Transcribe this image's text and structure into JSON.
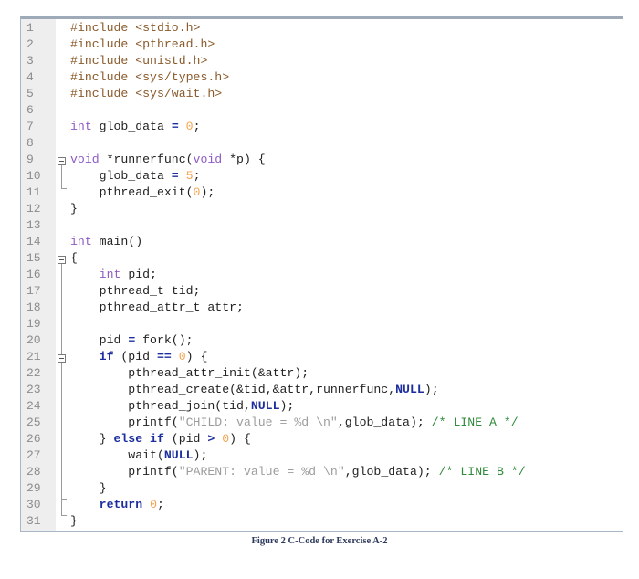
{
  "editor": {
    "lines": [
      {
        "n": "1",
        "code": "#include <stdio.h>"
      },
      {
        "n": "2",
        "code": "#include <pthread.h>"
      },
      {
        "n": "3",
        "code": "#include <unistd.h>"
      },
      {
        "n": "4",
        "code": "#include <sys/types.h>"
      },
      {
        "n": "5",
        "code": "#include <sys/wait.h>"
      },
      {
        "n": "6",
        "code": ""
      },
      {
        "n": "7",
        "code": "int glob_data = 0;"
      },
      {
        "n": "8",
        "code": ""
      },
      {
        "n": "9",
        "code": "void *runnerfunc(void *p) {"
      },
      {
        "n": "10",
        "code": "    glob_data = 5;"
      },
      {
        "n": "11",
        "code": "    pthread_exit(0);"
      },
      {
        "n": "12",
        "code": "}"
      },
      {
        "n": "13",
        "code": ""
      },
      {
        "n": "14",
        "code": "int main()"
      },
      {
        "n": "15",
        "code": "{"
      },
      {
        "n": "16",
        "code": "    int pid;"
      },
      {
        "n": "17",
        "code": "    pthread_t tid;"
      },
      {
        "n": "18",
        "code": "    pthread_attr_t attr;"
      },
      {
        "n": "19",
        "code": ""
      },
      {
        "n": "20",
        "code": "    pid = fork();"
      },
      {
        "n": "21",
        "code": "    if (pid == 0) {"
      },
      {
        "n": "22",
        "code": "        pthread_attr_init(&attr);"
      },
      {
        "n": "23",
        "code": "        pthread_create(&tid,&attr,runnerfunc,NULL);"
      },
      {
        "n": "24",
        "code": "        pthread_join(tid,NULL);"
      },
      {
        "n": "25",
        "code": "        printf(\"CHILD: value = %d \\n\",glob_data); /* LINE A */"
      },
      {
        "n": "26",
        "code": "    } else if (pid > 0) {"
      },
      {
        "n": "27",
        "code": "        wait(NULL);"
      },
      {
        "n": "28",
        "code": "        printf(\"PARENT: value = %d \\n\",glob_data); /* LINE B */"
      },
      {
        "n": "29",
        "code": "    }"
      },
      {
        "n": "30",
        "code": "    return 0;"
      },
      {
        "n": "31",
        "code": "}"
      }
    ],
    "tokens": {
      "l1": [
        "#include ",
        "<stdio.h>"
      ],
      "l2": [
        "#include ",
        "<pthread.h>"
      ],
      "l3": [
        "#include ",
        "<unistd.h>"
      ],
      "l4": [
        "#include ",
        "<sys/types.h>"
      ],
      "l5": [
        "#include ",
        "<sys/wait.h>"
      ],
      "l7": [
        "int",
        " glob_data ",
        "=",
        " ",
        "0",
        ";"
      ],
      "l9": [
        "void",
        " *runnerfunc(",
        "void",
        " *p) {"
      ],
      "l10": [
        "    glob_data ",
        "=",
        " ",
        "5",
        ";"
      ],
      "l11": [
        "    pthread_exit(",
        "0",
        ");"
      ],
      "l12": [
        "}"
      ],
      "l14": [
        "int",
        " main()"
      ],
      "l15": [
        "{"
      ],
      "l16": [
        "    ",
        "int",
        " pid;"
      ],
      "l17": [
        "    pthread_t tid;"
      ],
      "l18": [
        "    pthread_attr_t attr;"
      ],
      "l20": [
        "    pid ",
        "=",
        " fork();"
      ],
      "l21": [
        "    ",
        "if",
        " (pid ",
        "==",
        " ",
        "0",
        ") {"
      ],
      "l22": [
        "        pthread_attr_init(&attr);"
      ],
      "l23": [
        "        pthread_create(&tid,&attr,runnerfunc,",
        "NULL",
        ");"
      ],
      "l24": [
        "        pthread_join(tid,",
        "NULL",
        ");"
      ],
      "l25": [
        "        printf(",
        "\"CHILD: value = %d \\n\"",
        ",glob_data); ",
        "/* LINE A */"
      ],
      "l26": [
        "    } ",
        "else if",
        " (pid ",
        ">",
        " ",
        "0",
        ") {"
      ],
      "l27": [
        "        wait(",
        "NULL",
        ");"
      ],
      "l28": [
        "        printf(",
        "\"PARENT: value = %d \\n\"",
        ",glob_data); ",
        "/* LINE B */"
      ],
      "l29": [
        "    }"
      ],
      "l30": [
        "    ",
        "return",
        " ",
        "0",
        ";"
      ],
      "l31": [
        "}"
      ]
    }
  },
  "caption": "Figure 2 C-Code for Exercise A-2"
}
